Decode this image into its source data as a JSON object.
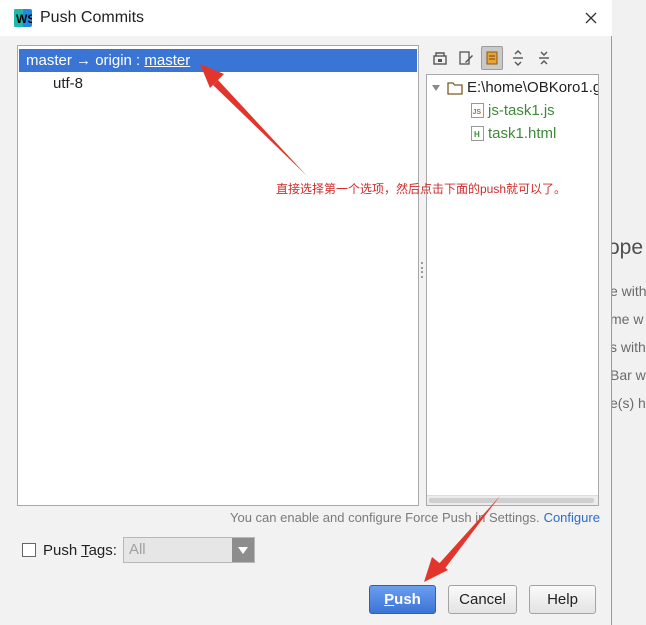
{
  "window": {
    "title": "Push Commits"
  },
  "repo_tree": {
    "selected_row": {
      "local": "master",
      "arrow": "→",
      "remote": "origin",
      "separator": " : ",
      "target": "master"
    },
    "child": "utf-8"
  },
  "toolbar": {
    "icons": [
      "group-by-icon",
      "edit-source-icon",
      "show-diff-icon",
      "expand-all-icon",
      "collapse-all-icon"
    ]
  },
  "file_tree": {
    "root": "E:\\home\\OBKoro1.g",
    "files": [
      {
        "name": "js-task1.js",
        "icon": "js-file-icon"
      },
      {
        "name": "task1.html",
        "icon": "html-file-icon"
      }
    ]
  },
  "force_push_info": {
    "text": "You can enable and configure Force Push in Settings.",
    "link": "Configure"
  },
  "push_tags": {
    "label_prefix": "Push ",
    "label_mnemonic": "T",
    "label_rest": "ags:",
    "combo_value": "All",
    "checked": false
  },
  "buttons": {
    "push_mnemonic": "P",
    "push_rest": "ush",
    "cancel": "Cancel",
    "help": "Help"
  },
  "annotation": {
    "text": "直接选择第一个选项，然后点击下面的push就可以了。",
    "color": "#d02b2b"
  },
  "background_app": {
    "heading": "ope",
    "lines": [
      "e with",
      "me w",
      "s with",
      "Bar w",
      "e(s) h"
    ]
  },
  "colors": {
    "selection": "#3a75d6",
    "file_green": "#3e8a3a",
    "link": "#2a6bc9",
    "annotation": "#d02b2b"
  }
}
